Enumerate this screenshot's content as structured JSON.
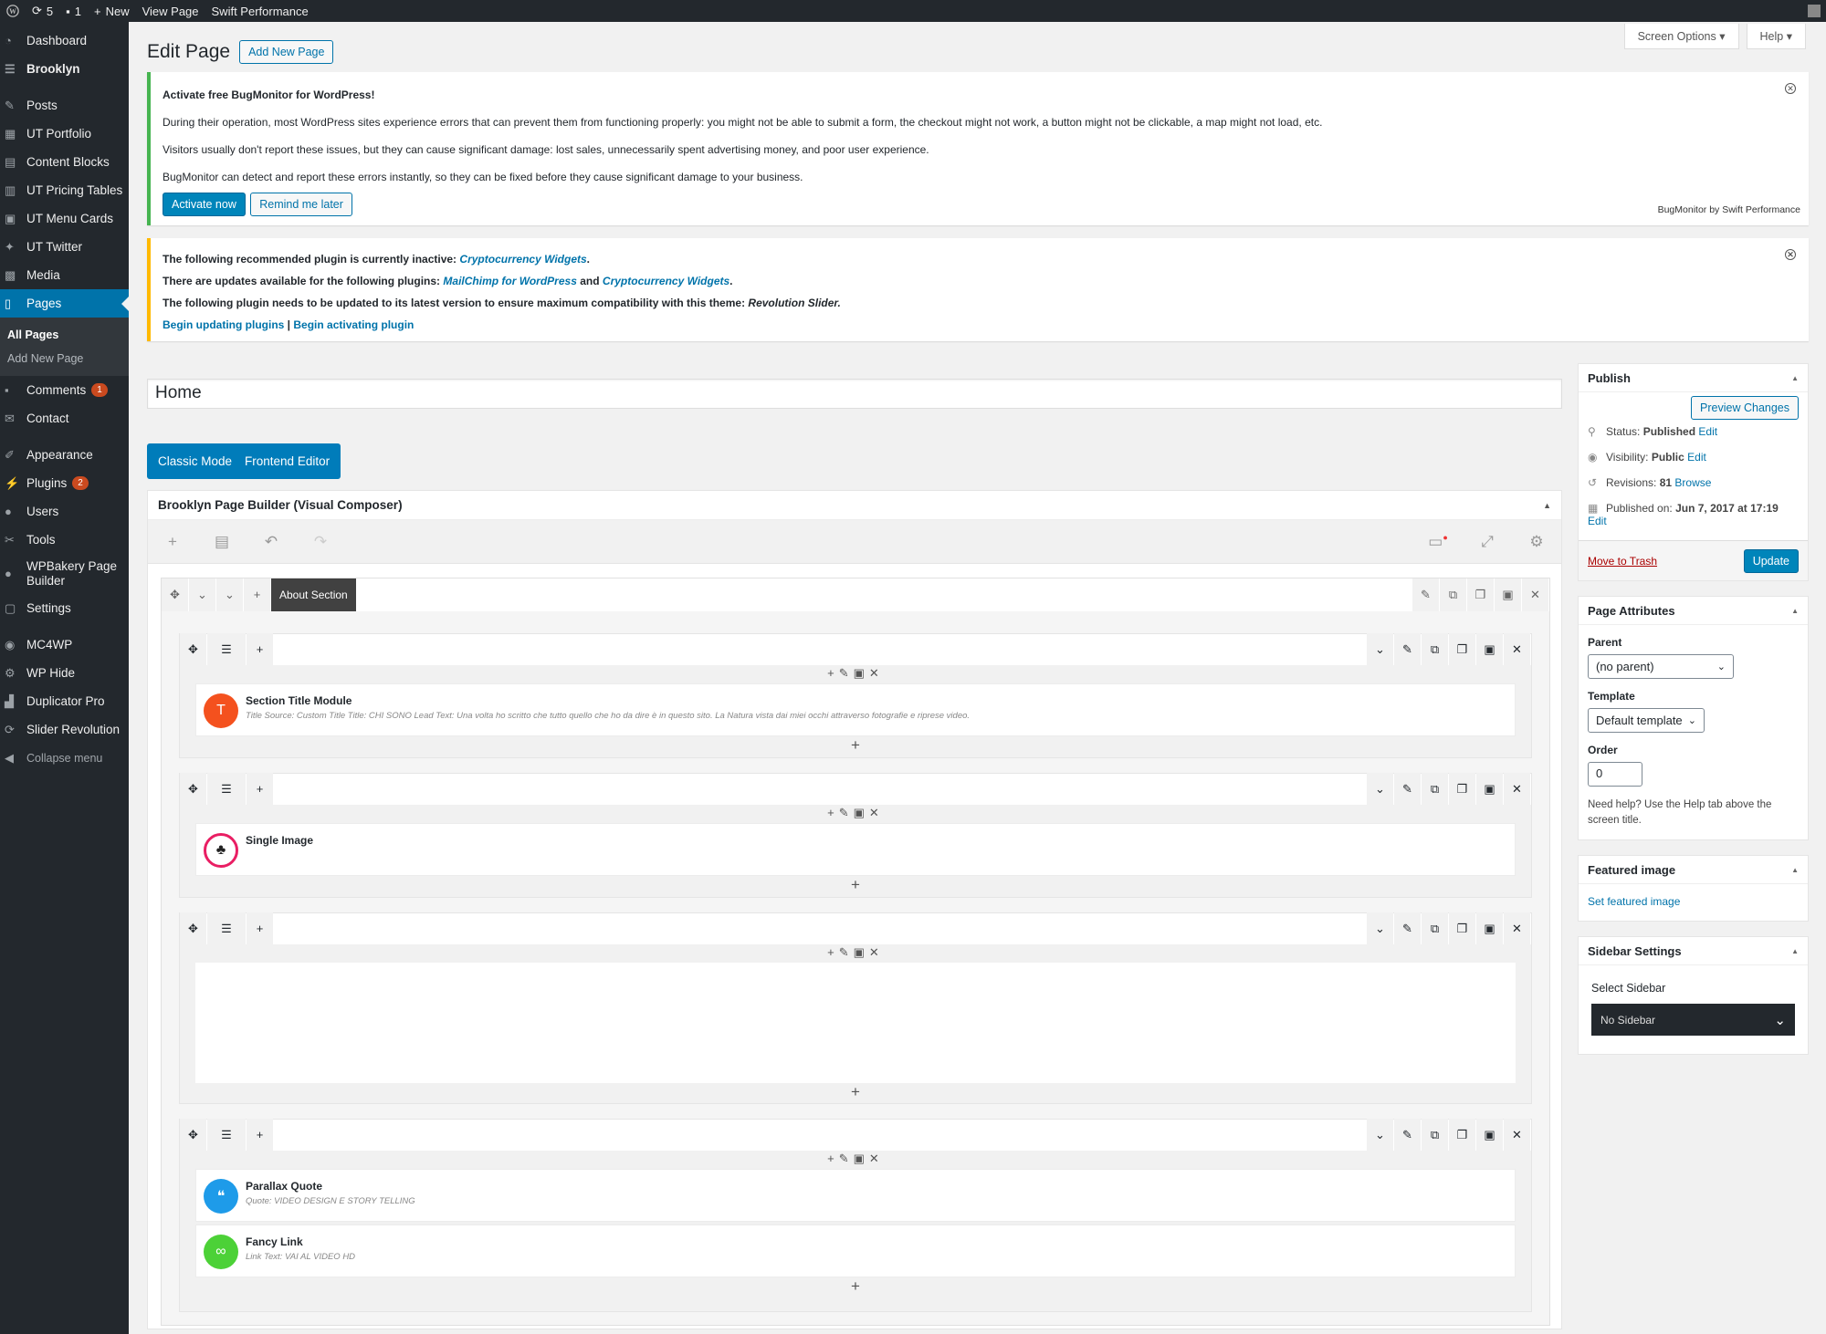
{
  "adminbar": {
    "updates": "5",
    "comments": "1",
    "new_label": "New",
    "view_page": "View Page",
    "swift": "Swift Performance"
  },
  "sidebar": {
    "items": [
      "Dashboard",
      "Brooklyn",
      "Posts",
      "UT Portfolio",
      "Content Blocks",
      "UT Pricing Tables",
      "UT Menu Cards",
      "UT Twitter",
      "Media",
      "Pages",
      "Comments",
      "Contact",
      "Appearance",
      "Plugins",
      "Users",
      "Tools",
      "WPBakery Page Builder",
      "Settings",
      "MC4WP",
      "WP Hide",
      "Duplicator Pro",
      "Slider Revolution",
      "Collapse menu"
    ],
    "sub": [
      "All Pages",
      "Add New Page"
    ],
    "comments_badge": "1",
    "plugins_badge": "2"
  },
  "top_buttons": {
    "screen_options": "Screen Options",
    "help": "Help"
  },
  "page_title": "Edit Page",
  "add_new": "Add New Page",
  "notice1": {
    "title": "Activate free BugMonitor for WordPress!",
    "p1": "During their operation, most WordPress sites experience errors that can prevent them from functioning properly: you might not be able to submit a form, the checkout might not work, a button might not be clickable, a map might not load, etc.",
    "p2": "Visitors usually don't report these issues, but they can cause significant damage: lost sales, unnecessarily spent advertising money, and poor user experience.",
    "p3": "BugMonitor can detect and report these errors instantly, so they can be fixed before they cause significant damage to your business.",
    "activate": "Activate now",
    "remind": "Remind me later",
    "credit": "BugMonitor by Swift Performance"
  },
  "notice2": {
    "l1a": "The following recommended plugin is currently inactive:",
    "l1link": "Cryptocurrency Widgets",
    "l2a": "There are updates available for the following plugins:",
    "l2link1": "MailChimp for WordPress",
    "l2and": "and",
    "l2link2": "Cryptocurrency Widgets",
    "l3a": "The following plugin needs to be updated to its latest version to ensure maximum compatibility with this theme:",
    "l3b": "Revolution Slider.",
    "link_update": "Begin updating plugins",
    "sep": "|",
    "link_activate": "Begin activating plugin"
  },
  "title_value": "Home",
  "modes": {
    "classic": "Classic Mode",
    "frontend": "Frontend Editor"
  },
  "builder": {
    "title": "Brooklyn Page Builder (Visual Composer)",
    "row_label": "About Section"
  },
  "elements": {
    "e1": {
      "name": "Section Title Module",
      "desc": "Title Source: Custom Title  Title: CHI SONO  Lead Text: Una volta ho scritto che tutto quello che ho da dire è in questo sito. La Natura vista dai miei occhi attraverso fotografie e riprese video."
    },
    "e2": {
      "name": "Single Image"
    },
    "e3": {
      "name": "Parallax Quote",
      "desc": "Quote: VIDEO DESIGN E STORY TELLING"
    },
    "e4": {
      "name": "Fancy Link",
      "desc": "Link Text: VAI AL VIDEO HD"
    }
  },
  "publish": {
    "title": "Publish",
    "preview": "Preview Changes",
    "status_label": "Status:",
    "status": "Published",
    "edit": "Edit",
    "visibility_label": "Visibility:",
    "visibility": "Public",
    "revisions_label": "Revisions:",
    "revisions": "81",
    "browse": "Browse",
    "published_label": "Published on:",
    "published": "Jun 7, 2017 at 17:19",
    "trash": "Move to Trash",
    "update": "Update"
  },
  "attributes": {
    "title": "Page Attributes",
    "parent_label": "Parent",
    "parent": "(no parent)",
    "template_label": "Template",
    "template": "Default template",
    "order_label": "Order",
    "order": "0",
    "help": "Need help? Use the Help tab above the screen title."
  },
  "featured": {
    "title": "Featured image",
    "link": "Set featured image"
  },
  "sidebar_settings": {
    "title": "Sidebar Settings",
    "label": "Select Sidebar",
    "value": "No Sidebar"
  },
  "colors": {
    "accent": "#0073aa",
    "admin_dark": "#23282d",
    "notice_green": "#46b450",
    "notice_yellow": "#ffb900",
    "e1": "#f4511e",
    "e2": "#e91e63",
    "e3": "#1e9be9",
    "e4": "#4cd137"
  }
}
